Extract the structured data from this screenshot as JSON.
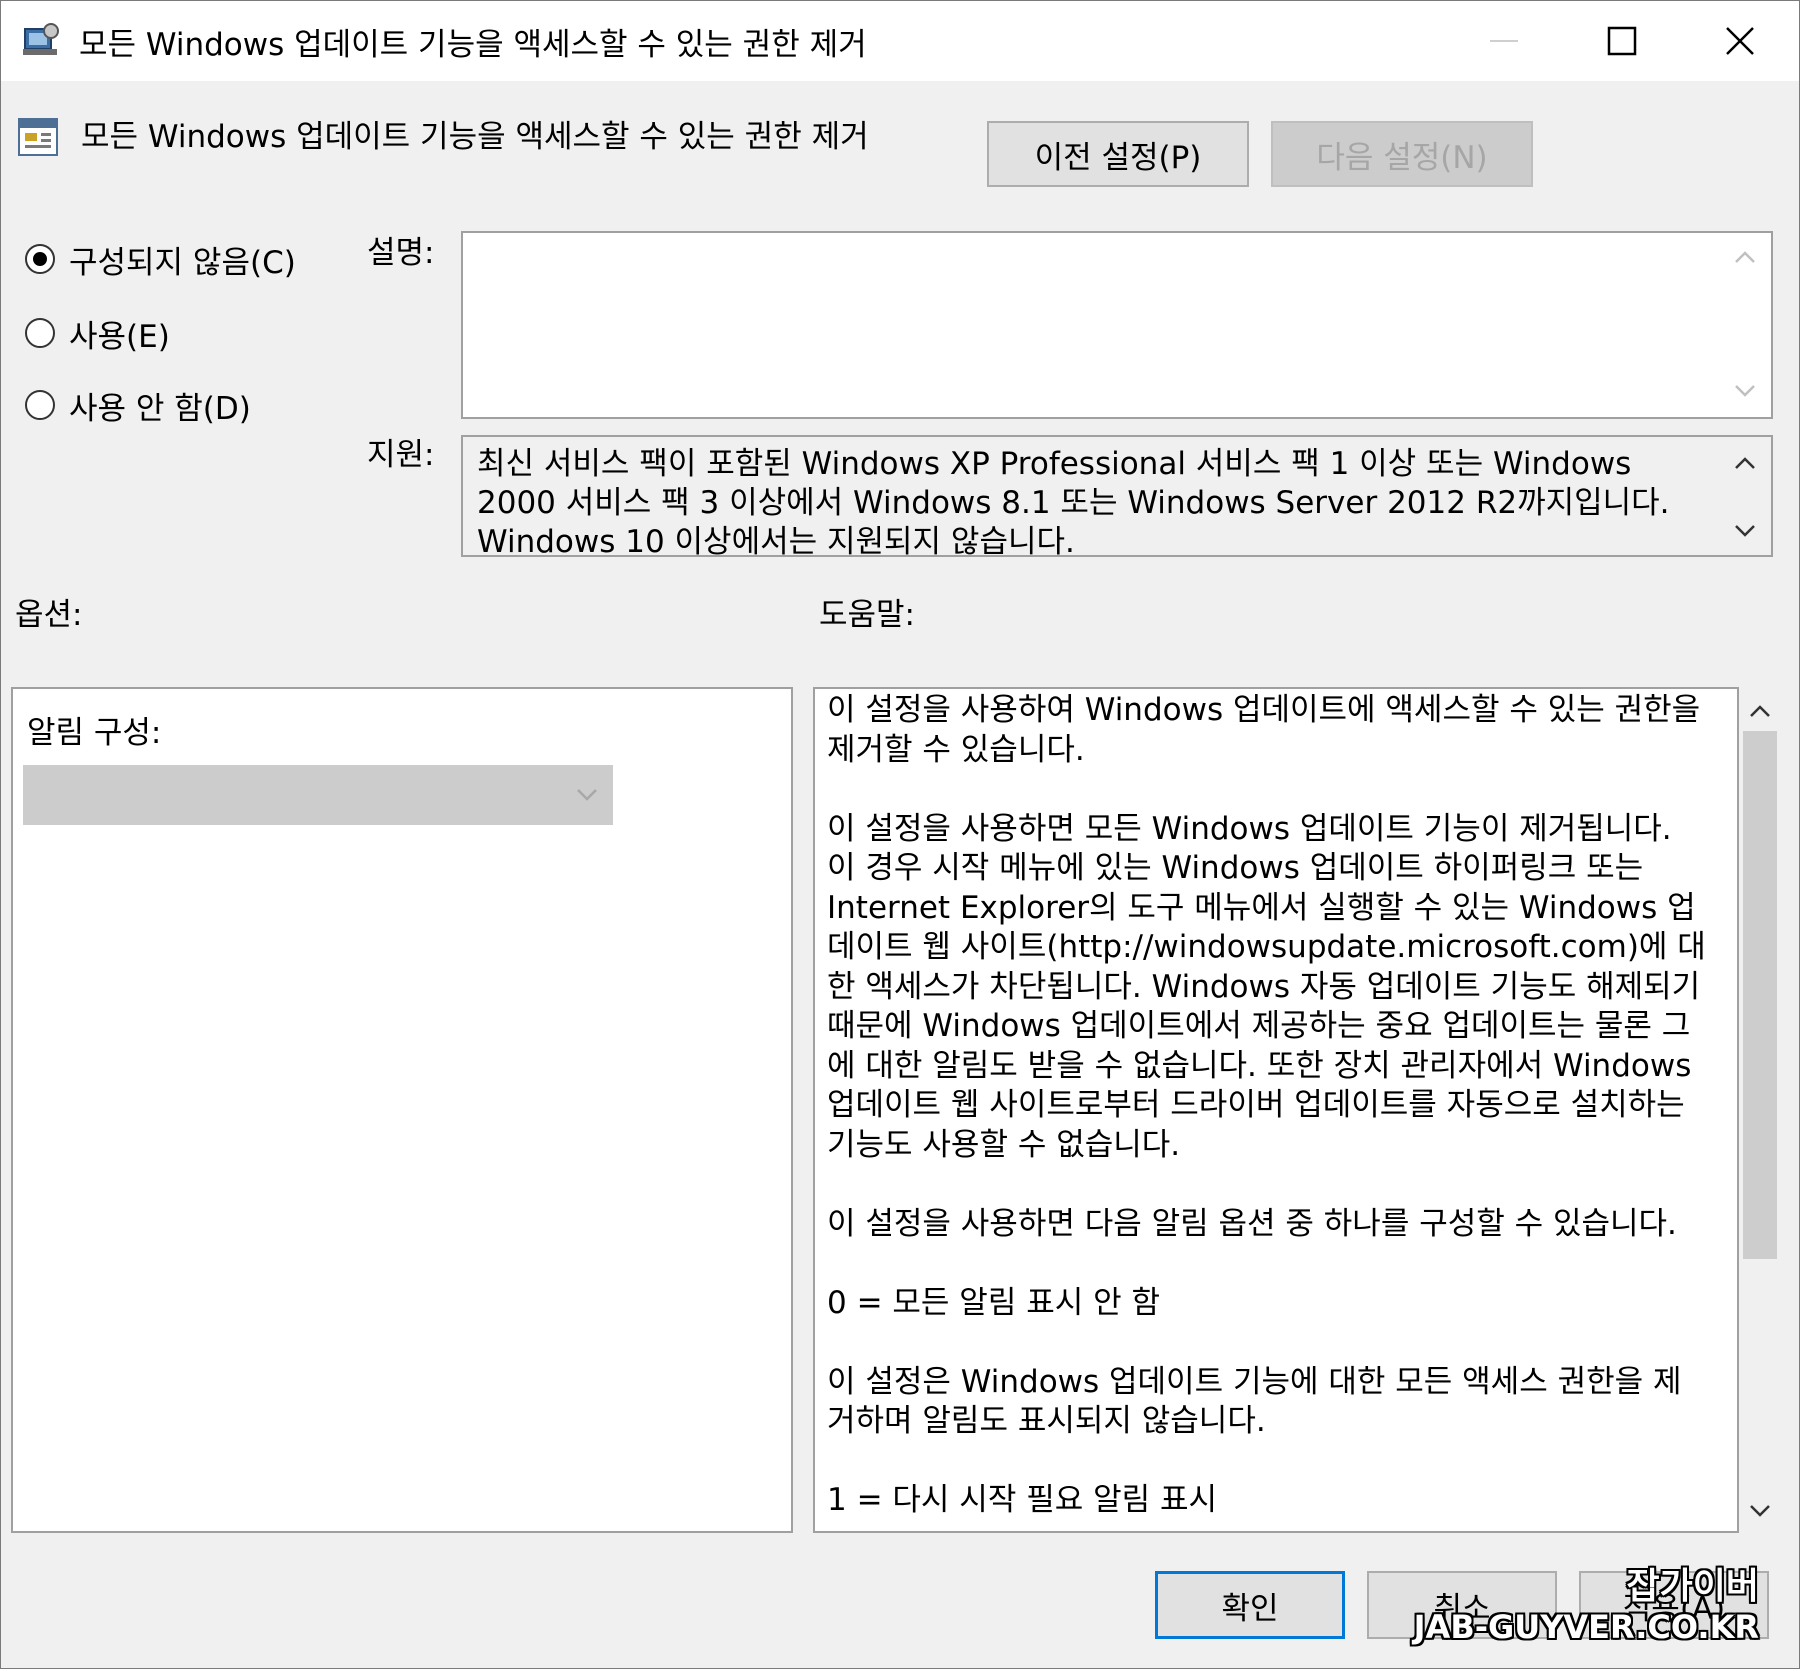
{
  "window": {
    "title": "모든 Windows 업데이트 기능을 액세스할 수 있는 권한 제거"
  },
  "header": {
    "setting_title": "모든 Windows 업데이트 기능을 액세스할 수 있는 권한 제거",
    "prev_button": "이전 설정(P)",
    "next_button": "다음 설정(N)"
  },
  "state": {
    "options": [
      {
        "label": "구성되지 않음(C)",
        "checked": true
      },
      {
        "label": "사용(E)",
        "checked": false
      },
      {
        "label": "사용 안 함(D)",
        "checked": false
      }
    ]
  },
  "comment": {
    "label": "설명:",
    "value": ""
  },
  "supported": {
    "label": "지원:",
    "lines": [
      "최신 서비스 팩이 포함된 Windows XP Professional 서비스 팩 1 이상 또는 Windows",
      "2000 서비스 팩 3 이상에서 Windows 8.1 또는 Windows Server 2012 R2까지입니다.",
      "Windows 10 이상에서는 지원되지 않습니다."
    ]
  },
  "options_section": {
    "label": "옵션:",
    "notification_label": "알림 구성:",
    "notification_value": ""
  },
  "help_section": {
    "label": "도움말:",
    "paragraphs": [
      "이 설정을 사용하여 Windows 업데이트에 액세스할 수 있는 권한을 제거할 수 있습니다.",
      "이 설정을 사용하면 모든 Windows 업데이트 기능이 제거됩니다. 이 경우 시작 메뉴에 있는 Windows 업데이트 하이퍼링크 또는 Internet Explorer의 도구 메뉴에서 실행할 수 있는 Windows 업데이트 웹 사이트(http://windowsupdate.microsoft.com)에 대한 액세스가 차단됩니다. Windows 자동 업데이트 기능도 해제되기 때문에 Windows 업데이트에서 제공하는 중요 업데이트는 물론 그에 대한 알림도 받을 수 없습니다. 또한 장치 관리자에서 Windows 업데이트 웹 사이트로부터 드라이버 업데이트를 자동으로 설치하는 기능도 사용할 수 없습니다.",
      "이 설정을 사용하면 다음 알림 옵션 중 하나를 구성할 수 있습니다.",
      "0 = 모든 알림 표시 안 함",
      "이 설정은 Windows 업데이트 기능에 대한 모든 액세스 권한을 제거하며 알림도 표시되지 않습니다.",
      "1 = 다시 시작 필요 알림 표시"
    ]
  },
  "footer": {
    "ok_button": "확인",
    "cancel_button": "취소",
    "apply_button": "적용(A)"
  },
  "watermark": {
    "line1": "잡가이버",
    "line2": "JAB-GUYVER.CO.KR"
  },
  "icons": {
    "title": "policy-setting-icon",
    "header": "policy-page-icon",
    "minimize": "minimize-icon",
    "maximize": "maximize-icon",
    "close": "close-icon"
  },
  "colors": {
    "accent": "#0078d7",
    "window_bg": "#f0f0f0",
    "disabled_text": "#a6a6a6"
  }
}
